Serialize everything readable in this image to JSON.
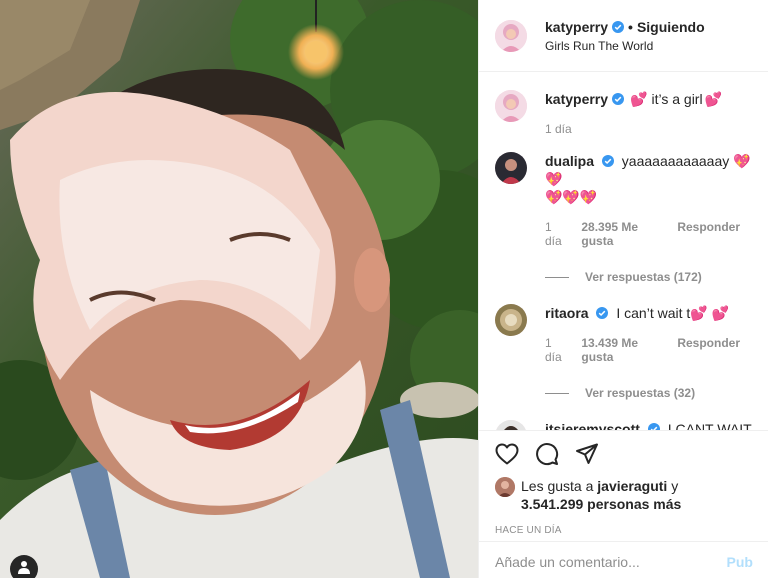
{
  "post": {
    "author": "katyperry",
    "follow_label": "Siguiendo",
    "separator": "•",
    "subtitle": "Girls Run The World"
  },
  "comments": [
    {
      "username": "katyperry",
      "text": "it’s a girl",
      "emoji_before": "💕",
      "emoji_after": "💕",
      "time": "1 día",
      "verified": true
    },
    {
      "username": "dualipa",
      "text": "yaaaaaaaaaaaay",
      "emoji_after": "💖💖",
      "emoji_line2": "💖💖💖",
      "time": "1 día",
      "likes": "28.395 Me gusta",
      "reply": "Responder",
      "view_replies": "Ver respuestas (172)",
      "verified": true
    },
    {
      "username": "ritaora",
      "text": "I can’t wait t",
      "emoji_after": "💕 💕",
      "time": "1 día",
      "likes": "13.439 Me gusta",
      "reply": "Responder",
      "view_replies": "Ver respuestas (32)",
      "verified": true
    },
    {
      "username": "itsjeremyscott",
      "text": "I CANT WAIT TO DRESS HER !!!",
      "emoji_after": "💘",
      "verified": true
    }
  ],
  "actions": {
    "like_icon": "heart-icon",
    "comment_icon": "speech-bubble-icon",
    "share_icon": "paper-plane-icon"
  },
  "likes": {
    "prefix": "Les gusta a",
    "user": "javieraguti",
    "conj": "y",
    "others": "3.541.299 personas más"
  },
  "timestamp": "HACE UN DÍA",
  "add_comment": {
    "placeholder": "Añade un comentario...",
    "publish_label": "Pub"
  },
  "colors": {
    "verified_blue": "#3897f0",
    "muted": "#8e8e8e",
    "publish_disabled": "#b2dffc"
  }
}
